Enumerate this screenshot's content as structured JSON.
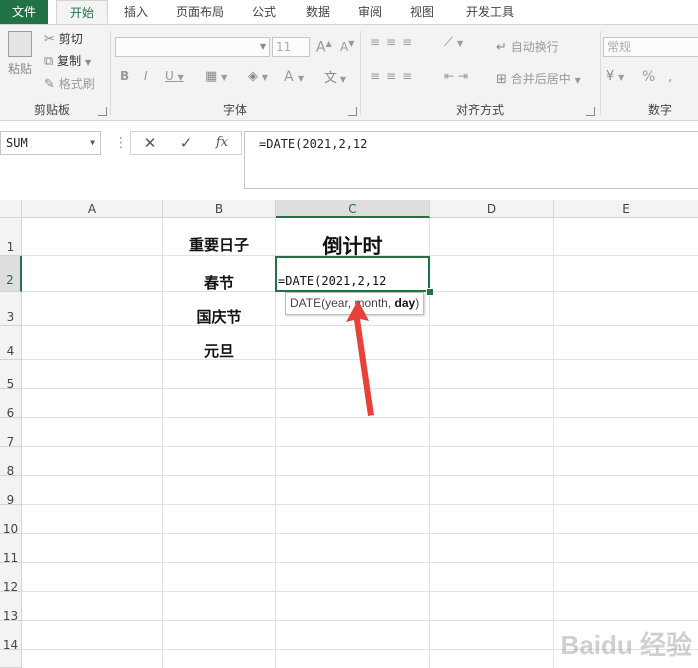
{
  "tabs": [
    "文件",
    "开始",
    "插入",
    "页面布局",
    "公式",
    "数据",
    "审阅",
    "视图",
    "开发工具"
  ],
  "ribbon": {
    "clipboard": {
      "paste": "粘贴",
      "cut": "剪切",
      "copy": "复制",
      "format_painter": "格式刷",
      "label": "剪贴板"
    },
    "font": {
      "size": "11",
      "label": "字体"
    },
    "alignment": {
      "wrap": "自动换行",
      "merge": "合并后居中",
      "label": "对齐方式"
    },
    "number": {
      "format": "常规",
      "label": "数字"
    }
  },
  "formula_bar": {
    "name_box": "SUM",
    "fx": "fx",
    "content": "=DATE(2021,2,12"
  },
  "columns": [
    "A",
    "B",
    "C",
    "D",
    "E"
  ],
  "rows": [
    "1",
    "2",
    "3",
    "4",
    "5",
    "6",
    "7",
    "8",
    "9",
    "10",
    "11",
    "12",
    "13",
    "14"
  ],
  "cells": {
    "B1": "重要日子",
    "C1": "倒计时",
    "B2": "春节",
    "B3": "国庆节",
    "B4": "元旦"
  },
  "editing": {
    "cell": "C2",
    "text": "=DATE(2021,2,12"
  },
  "tooltip": {
    "fn": "DATE",
    "args": "(year, month, ",
    "current": "day",
    "close": ")"
  },
  "watermark": "Baidu 经验",
  "colors": {
    "accent": "#217346",
    "arrow": "#e8413a"
  }
}
